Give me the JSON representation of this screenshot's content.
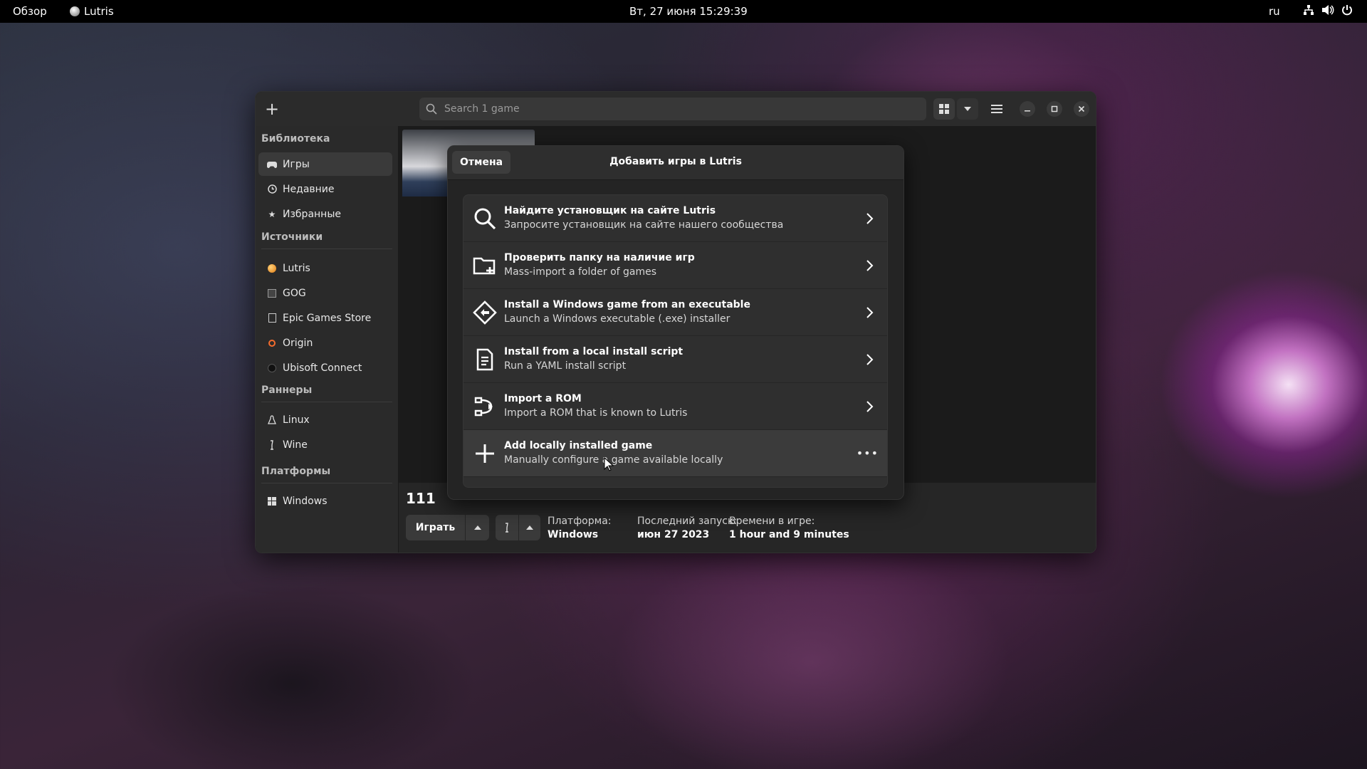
{
  "topbar": {
    "overview": "Обзор",
    "app_name": "Lutris",
    "clock": "Вт, 27 июня  15:29:39",
    "lang": "ru"
  },
  "window": {
    "search_placeholder": "Search 1 game"
  },
  "sidebar": {
    "library_title": "Библиотека",
    "library": [
      {
        "label": "Игры",
        "icon": "gamepad-icon"
      },
      {
        "label": "Недавние",
        "icon": "clock-icon"
      },
      {
        "label": "Избранные",
        "icon": "star-icon"
      }
    ],
    "sources_title": "Источники",
    "sources": [
      {
        "label": "Lutris",
        "icon": "lutris-icon"
      },
      {
        "label": "GOG",
        "icon": "gog-icon"
      },
      {
        "label": "Epic Games Store",
        "icon": "epic-icon"
      },
      {
        "label": "Origin",
        "icon": "origin-icon"
      },
      {
        "label": "Ubisoft Connect",
        "icon": "ubisoft-icon"
      }
    ],
    "runners_title": "Раннеры",
    "runners": [
      {
        "label": "Linux",
        "icon": "linux-icon"
      },
      {
        "label": "Wine",
        "icon": "wine-icon"
      }
    ],
    "platforms_title": "Платформы",
    "platforms": [
      {
        "label": "Windows",
        "icon": "windows-icon"
      }
    ]
  },
  "game": {
    "name": "111",
    "play_label": "Играть",
    "platform_label": "Платформа:",
    "platform_value": "Windows",
    "last_played_label": "Последний запуск:",
    "last_played_value": "июн 27 2023",
    "playtime_label": "Времени в игре:",
    "playtime_value": "1 hour and 9 minutes"
  },
  "dialog": {
    "cancel_label": "Отмена",
    "title": "Добавить игры в Lutris",
    "options": [
      {
        "title": "Найдите установщик на сайте Lutris",
        "subtitle": "Запросите установщик на сайте нашего сообщества",
        "icon": "search-icon"
      },
      {
        "title": "Проверить папку на наличие игр",
        "subtitle": "Mass-import a folder of games",
        "icon": "folder-add-icon"
      },
      {
        "title": "Install a Windows game from an executable",
        "subtitle": "Launch a Windows executable (.exe) installer",
        "icon": "executable-icon"
      },
      {
        "title": "Install from a local install script",
        "subtitle": "Run a YAML install script",
        "icon": "script-icon"
      },
      {
        "title": "Import a ROM",
        "subtitle": "Import a ROM that is known to Lutris",
        "icon": "rom-icon"
      },
      {
        "title": "Add locally installed game",
        "subtitle": "Manually configure a game available locally",
        "icon": "plus-icon"
      }
    ]
  }
}
